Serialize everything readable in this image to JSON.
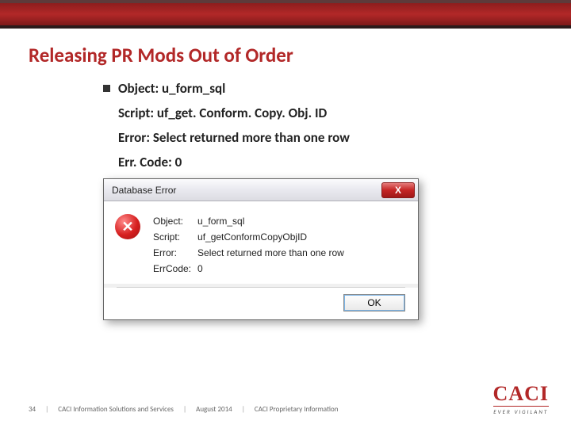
{
  "slide": {
    "title": "Releasing PR Mods Out of Order",
    "bullet": "Object: u_form_sql",
    "lines": [
      "Script: uf_get. Conform. Copy. Obj. ID",
      "Error: Select returned more than one row",
      "Err. Code: 0"
    ]
  },
  "dialog": {
    "title": "Database Error",
    "close_x": "X",
    "icon_x": "✕",
    "rows": {
      "object_lbl": "Object:",
      "object_val": "u_form_sql",
      "script_lbl": "Script:",
      "script_val": "uf_getConformCopyObjID",
      "error_lbl": "Error:",
      "error_val": "Select returned more than one row",
      "code_lbl": "ErrCode:",
      "code_val": "0"
    },
    "ok": "OK"
  },
  "footer": {
    "page": "34",
    "sep": "|",
    "org": "CACI Information Solutions and Services",
    "date": "August 2014",
    "prop": "CACI Proprietary Information"
  },
  "logo": {
    "main": "CACI",
    "sub": "EVER VIGILANT"
  }
}
